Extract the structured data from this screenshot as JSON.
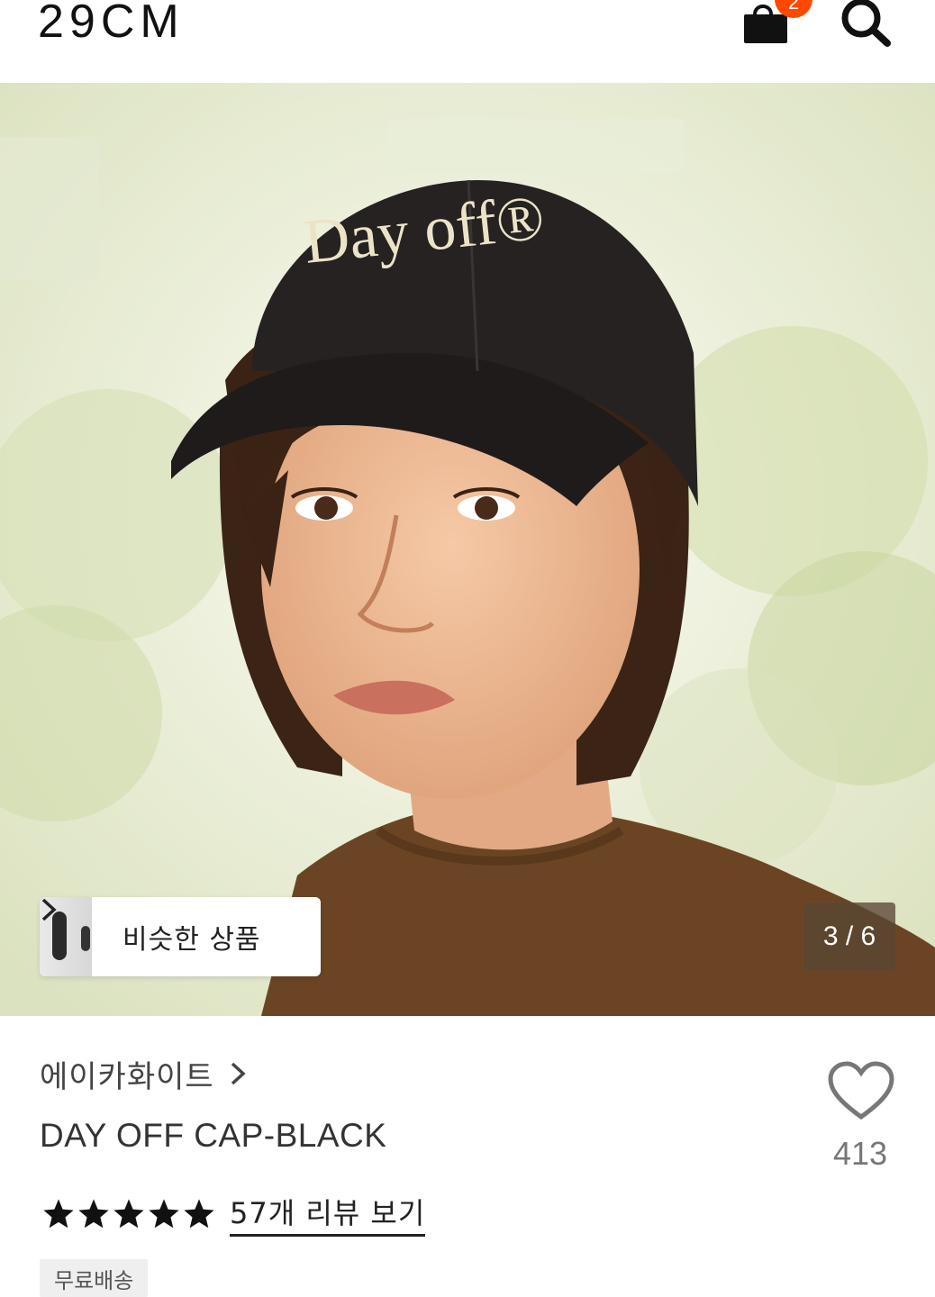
{
  "header": {
    "logo": "29CM",
    "cart_badge": "2",
    "icons": [
      "shopping-bag-icon",
      "search-icon"
    ]
  },
  "gallery": {
    "similar_label": "비슷한 상품",
    "counter": "3 / 6",
    "current": 3,
    "total": 6,
    "image_text": "Day off®"
  },
  "product": {
    "brand": "에이카화이트",
    "name": "DAY OFF CAP-BLACK",
    "likes": "413",
    "rating": 5,
    "review_link": "57개 리뷰 보기",
    "tag": "무료배송"
  },
  "colors": {
    "accent": "#ff4800",
    "text": "#111111",
    "muted": "#777777",
    "counter_bg": "#5a4634"
  }
}
